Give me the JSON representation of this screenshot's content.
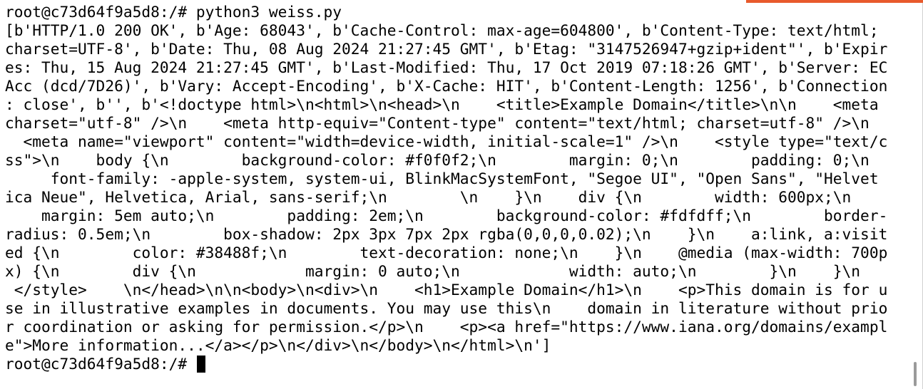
{
  "colors": {
    "accent": "#e85a2c",
    "background": "#ffffff",
    "foreground": "#000000"
  },
  "terminal": {
    "lines": [
      "root@c73d64f9a5d8:/# python3 weiss.py",
      "[b'HTTP/1.0 200 OK', b'Age: 68043', b'Cache-Control: max-age=604800', b'Content-Type: text/html;",
      "charset=UTF-8', b'Date: Thu, 08 Aug 2024 21:27:45 GMT', b'Etag: \"3147526947+gzip+ident\"', b'Expir",
      "es: Thu, 15 Aug 2024 21:27:45 GMT', b'Last-Modified: Thu, 17 Oct 2019 07:18:26 GMT', b'Server: EC",
      "Acc (dcd/7D26)', b'Vary: Accept-Encoding', b'X-Cache: HIT', b'Content-Length: 1256', b'Connection",
      ": close', b'', b'<!doctype html>\\n<html>\\n<head>\\n    <title>Example Domain</title>\\n\\n    <meta",
      "charset=\"utf-8\" />\\n    <meta http-equiv=\"Content-type\" content=\"text/html; charset=utf-8\" />\\n",
      "  <meta name=\"viewport\" content=\"width=device-width, initial-scale=1\" />\\n    <style type=\"text/c",
      "ss\">\\n    body {\\n        background-color: #f0f0f2;\\n        margin: 0;\\n        padding: 0;\\n",
      "     font-family: -apple-system, system-ui, BlinkMacSystemFont, \"Segoe UI\", \"Open Sans\", \"Helvet",
      "ica Neue\", Helvetica, Arial, sans-serif;\\n        \\n    }\\n    div {\\n        width: 600px;\\n",
      "    margin: 5em auto;\\n        padding: 2em;\\n        background-color: #fdfdff;\\n        border-",
      "radius: 0.5em;\\n        box-shadow: 2px 3px 7px 2px rgba(0,0,0,0.02);\\n    }\\n    a:link, a:visit",
      "ed {\\n        color: #38488f;\\n        text-decoration: none;\\n    }\\n    @media (max-width: 700p",
      "x) {\\n        div {\\n            margin: 0 auto;\\n            width: auto;\\n        }\\n    }\\n",
      " </style>    \\n</head>\\n\\n<body>\\n<div>\\n    <h1>Example Domain</h1>\\n    <p>This domain is for u",
      "se in illustrative examples in documents. You may use this\\n    domain in literature without prio",
      "r coordination or asking for permission.</p>\\n    <p><a href=\"https://www.iana.org/domains/exampl",
      "e\">More information...</a></p>\\n</div>\\n</body>\\n</html>\\n']"
    ],
    "prompt": "root@c73d64f9a5d8:/# "
  }
}
